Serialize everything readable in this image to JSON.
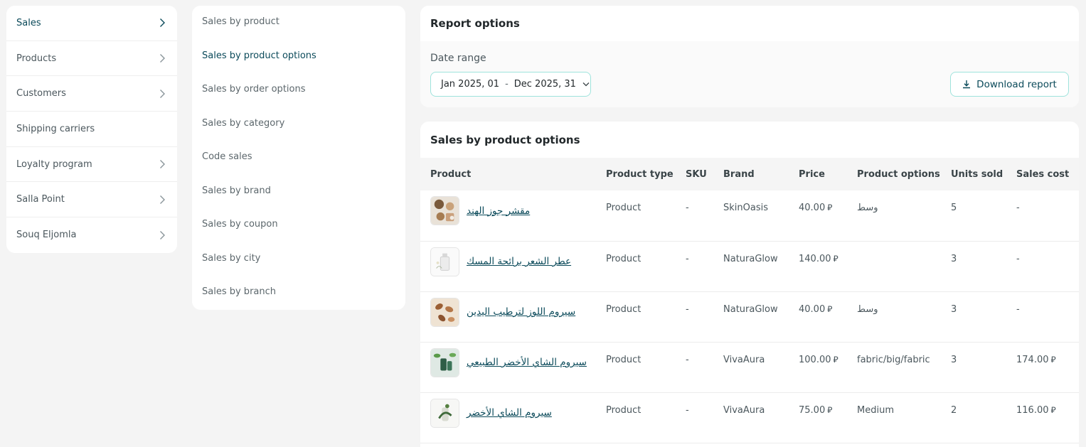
{
  "nav": {
    "items": [
      {
        "label": "Sales",
        "active": true,
        "chevron": true
      },
      {
        "label": "Products",
        "active": false,
        "chevron": true
      },
      {
        "label": "Customers",
        "active": false,
        "chevron": true
      },
      {
        "label": "Shipping carriers",
        "active": false,
        "chevron": false
      },
      {
        "label": "Loyalty program",
        "active": false,
        "chevron": true
      },
      {
        "label": "Salla Point",
        "active": false,
        "chevron": true
      },
      {
        "label": "Souq Eljomla",
        "active": false,
        "chevron": true
      }
    ]
  },
  "subnav": {
    "items": [
      {
        "label": "Sales by product",
        "active": false
      },
      {
        "label": "Sales by product options",
        "active": true
      },
      {
        "label": "Sales by order options",
        "active": false
      },
      {
        "label": "Sales by category",
        "active": false
      },
      {
        "label": "Code sales",
        "active": false
      },
      {
        "label": "Sales by brand",
        "active": false
      },
      {
        "label": "Sales by coupon",
        "active": false
      },
      {
        "label": "Sales by city",
        "active": false
      },
      {
        "label": "Sales by branch",
        "active": false
      }
    ]
  },
  "report_options": {
    "title": "Report options",
    "date_label": "Date range",
    "date_start": "Jan 2025, 01",
    "date_separator": "-",
    "date_end": "Dec 2025, 31",
    "download_label": "Download report"
  },
  "table": {
    "title": "Sales by product options",
    "columns": [
      "Product",
      "Product type",
      "SKU",
      "Brand",
      "Price",
      "Product options",
      "Units sold",
      "Sales cost"
    ],
    "currency_symbol": "⃁",
    "rows": [
      {
        "product": "مقشر جوز الهند",
        "type": "Product",
        "sku": "-",
        "brand": "SkinOasis",
        "price": "40.00",
        "options": "وسط",
        "units": "5",
        "cost": "-",
        "thumb": "coconut"
      },
      {
        "product": "عطر الشعر برائحة المسك",
        "type": "Product",
        "sku": "-",
        "brand": "NaturaGlow",
        "price": "140.00",
        "options": "",
        "units": "3",
        "cost": "-",
        "thumb": "perfume"
      },
      {
        "product": "سيروم اللوز لترطيب اليدين",
        "type": "Product",
        "sku": "-",
        "brand": "NaturaGlow",
        "price": "40.00",
        "options": "وسط",
        "units": "3",
        "cost": "-",
        "thumb": "almond"
      },
      {
        "product": "سيروم الشاي الأخضر الطبيعي",
        "type": "Product",
        "sku": "-",
        "brand": "VivaAura",
        "price": "100.00",
        "options": "fabric/big/fabric",
        "units": "3",
        "cost": "174.00",
        "thumb": "greentea"
      },
      {
        "product": "سيروم الشاي الأخضر",
        "type": "Product",
        "sku": "-",
        "brand": "VivaAura",
        "price": "75.00",
        "options": "Medium",
        "units": "2",
        "cost": "116.00",
        "thumb": "serum"
      }
    ]
  },
  "colors": {
    "accent": "#0b4a5a",
    "border_accent": "#9fe3dc",
    "background": "#f4f4f4"
  }
}
